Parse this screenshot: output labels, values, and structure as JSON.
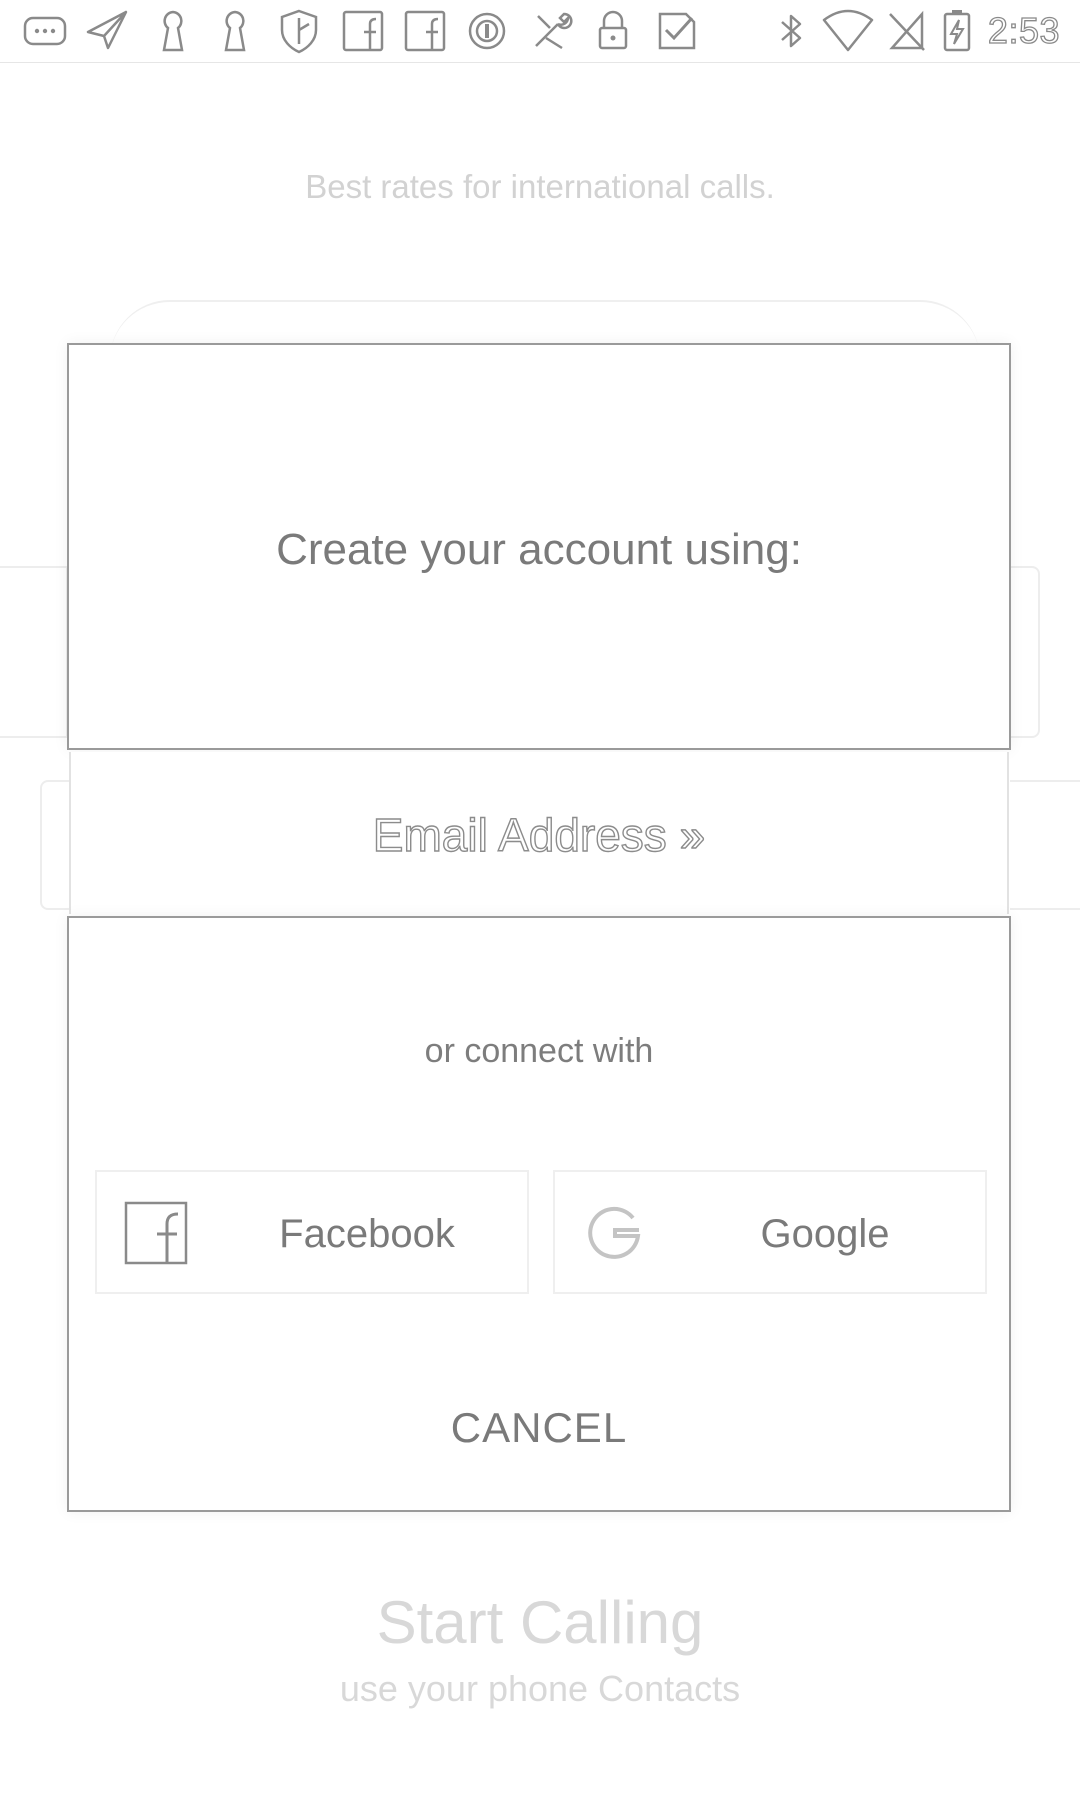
{
  "status_bar": {
    "time": "2:53",
    "icons": [
      "chat-bubble-icon",
      "send-icon",
      "keyhole-icon",
      "keyhole-icon",
      "shield-icon",
      "facebook-icon",
      "facebook-icon",
      "target-icon",
      "tools-icon",
      "lock-icon",
      "checkmark-icon",
      "bluetooth-icon",
      "wifi-icon",
      "no-sim-icon",
      "battery-charging-icon"
    ]
  },
  "background": {
    "tagline": "Best rates for international calls.",
    "start_calling": "Start Calling",
    "start_calling_sub": "use your phone Contacts"
  },
  "dialog": {
    "title": "Create your account using:",
    "email_option": "Email Address »",
    "connect_label": "or connect with",
    "facebook_label": "Facebook",
    "google_label": "Google",
    "cancel_label": "CANCEL"
  }
}
